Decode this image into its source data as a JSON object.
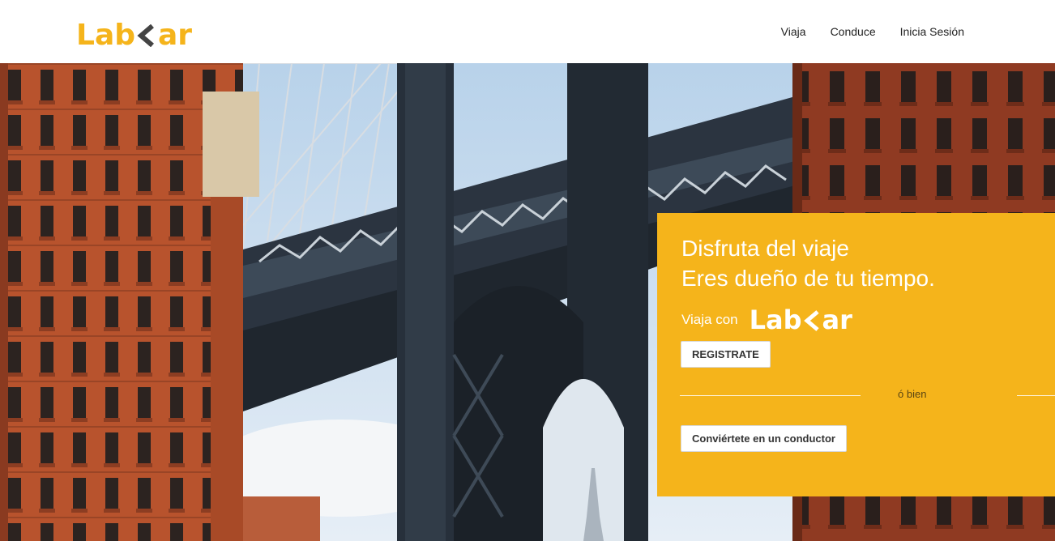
{
  "brand": {
    "name_part1": "Lab",
    "name_part2": "ar",
    "logo_color": "#f5b41b",
    "chevron_color": "#444444"
  },
  "nav": {
    "items": [
      {
        "label": "Viaja"
      },
      {
        "label": "Conduce"
      },
      {
        "label": "Inicia Sesión"
      }
    ]
  },
  "hero": {
    "image_description_icon": "bridge-photo",
    "card": {
      "background": "#f5b41b",
      "headline_line1": "Disfruta del viaje",
      "headline_line2": "Eres dueño de tu tiempo.",
      "tagline": "Viaja con",
      "register_label": "REGISTRATE",
      "or_label": "ó bien",
      "driver_label": "Conviértete en un conductor"
    }
  }
}
